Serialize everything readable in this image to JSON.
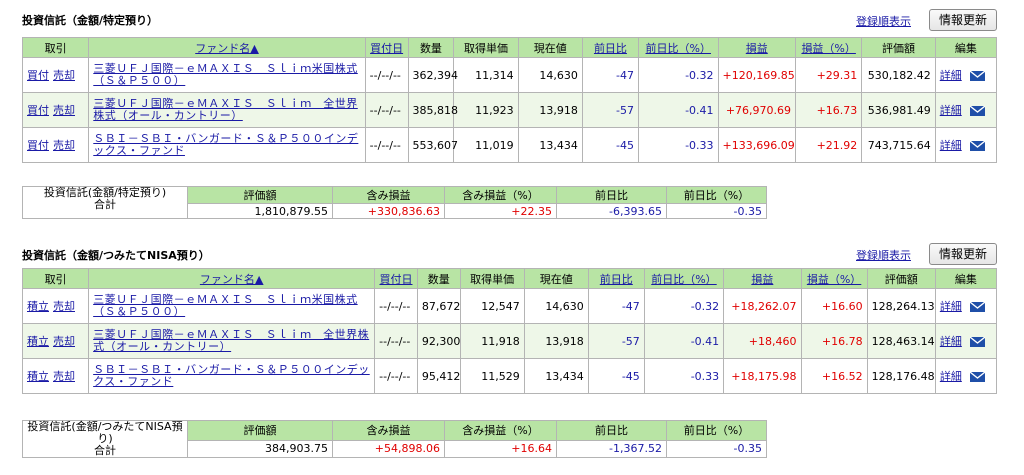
{
  "sections": [
    {
      "title": "投資信託（金額/特定預り）",
      "register_link": "登録順表示",
      "refresh_label": "情報更新",
      "headers": {
        "trade": "取引",
        "fund": "ファンド名▲",
        "buy_date": "買付日",
        "qty": "数量",
        "cost": "取得単価",
        "price": "現在値",
        "day_chg": "前日比",
        "day_pct": "前日比（%）",
        "pl": "損益",
        "pl_pct": "損益（%）",
        "value": "評価額",
        "edit": "編集"
      },
      "rows": [
        {
          "buy": "買付",
          "sell": "売却",
          "fund": "三菱ＵＦＪ国際－ｅＭＡＸＩＳ　Ｓｌｉｍ米国株式（Ｓ＆Ｐ５００）",
          "date": "--/--/--",
          "qty": "362,394",
          "cost": "11,314",
          "price": "14,630",
          "day_chg": "-47",
          "day_pct": "-0.32",
          "pl": "+120,169.85",
          "pl_pct": "+29.31",
          "value": "530,182.42",
          "detail": "詳細"
        },
        {
          "buy": "買付",
          "sell": "売却",
          "fund": "三菱ＵＦＪ国際－ｅＭＡＸＩＳ　Ｓｌｉｍ　全世界株式（オール・カントリー）",
          "date": "--/--/--",
          "qty": "385,818",
          "cost": "11,923",
          "price": "13,918",
          "day_chg": "-57",
          "day_pct": "-0.41",
          "pl": "+76,970.69",
          "pl_pct": "+16.73",
          "value": "536,981.49",
          "detail": "詳細"
        },
        {
          "buy": "買付",
          "sell": "売却",
          "fund": "ＳＢＩ－ＳＢＩ・バンガード・Ｓ＆Ｐ５００インデックス・ファンド",
          "date": "--/--/--",
          "qty": "553,607",
          "cost": "11,019",
          "price": "13,434",
          "day_chg": "-45",
          "day_pct": "-0.33",
          "pl": "+133,696.09",
          "pl_pct": "+21.92",
          "value": "743,715.64",
          "detail": "詳細"
        }
      ],
      "total": {
        "label1": "投資信託(金額/特定預り)",
        "label2": "合計",
        "h_value": "評価額",
        "h_pl": "含み損益",
        "h_pl_pct": "含み損益（%）",
        "h_day": "前日比",
        "h_day_pct": "前日比（%）",
        "value": "1,810,879.55",
        "pl": "+330,836.63",
        "pl_pct": "+22.35",
        "day": "-6,393.65",
        "day_pct": "-0.35"
      }
    },
    {
      "title": "投資信託（金額/つみたてNISA預り）",
      "register_link": "登録順表示",
      "refresh_label": "情報更新",
      "headers": {
        "trade": "取引",
        "fund": "ファンド名▲",
        "buy_date": "買付日",
        "qty": "数量",
        "cost": "取得単価",
        "price": "現在値",
        "day_chg": "前日比",
        "day_pct": "前日比（%）",
        "pl": "損益",
        "pl_pct": "損益（%）",
        "value": "評価額",
        "edit": "編集"
      },
      "rows": [
        {
          "buy": "積立",
          "sell": "売却",
          "fund": "三菱ＵＦＪ国際－ｅＭＡＸＩＳ　Ｓｌｉｍ米国株式（Ｓ＆Ｐ５００）",
          "date": "--/--/--",
          "qty": "87,672",
          "cost": "12,547",
          "price": "14,630",
          "day_chg": "-47",
          "day_pct": "-0.32",
          "pl": "+18,262.07",
          "pl_pct": "+16.60",
          "value": "128,264.13",
          "detail": "詳細"
        },
        {
          "buy": "積立",
          "sell": "売却",
          "fund": "三菱ＵＦＪ国際－ｅＭＡＸＩＳ　Ｓｌｉｍ　全世界株式（オール・カントリー）",
          "date": "--/--/--",
          "qty": "92,300",
          "cost": "11,918",
          "price": "13,918",
          "day_chg": "-57",
          "day_pct": "-0.41",
          "pl": "+18,460",
          "pl_pct": "+16.78",
          "value": "128,463.14",
          "detail": "詳細"
        },
        {
          "buy": "積立",
          "sell": "売却",
          "fund": "ＳＢＩ－ＳＢＩ・バンガード・Ｓ＆Ｐ５００インデックス・ファンド",
          "date": "--/--/--",
          "qty": "95,412",
          "cost": "11,529",
          "price": "13,434",
          "day_chg": "-45",
          "day_pct": "-0.33",
          "pl": "+18,175.98",
          "pl_pct": "+16.52",
          "value": "128,176.48",
          "detail": "詳細"
        }
      ],
      "total": {
        "label1": "投資信託(金額/つみたてNISA預り)",
        "label2": "合計",
        "h_value": "評価額",
        "h_pl": "含み損益",
        "h_pl_pct": "含み損益（%）",
        "h_day": "前日比",
        "h_day_pct": "前日比（%）",
        "value": "384,903.75",
        "pl": "+54,898.06",
        "pl_pct": "+16.64",
        "day": "-1,367.52",
        "day_pct": "-0.35"
      }
    }
  ],
  "colors": {
    "header_bg": "#b8e4a4",
    "link": "#1a1aa6",
    "positive": "#e00000",
    "negative": "#1a1aa6",
    "alt_row": "#eef7e8"
  },
  "icons": {
    "mail": "envelope-icon"
  }
}
